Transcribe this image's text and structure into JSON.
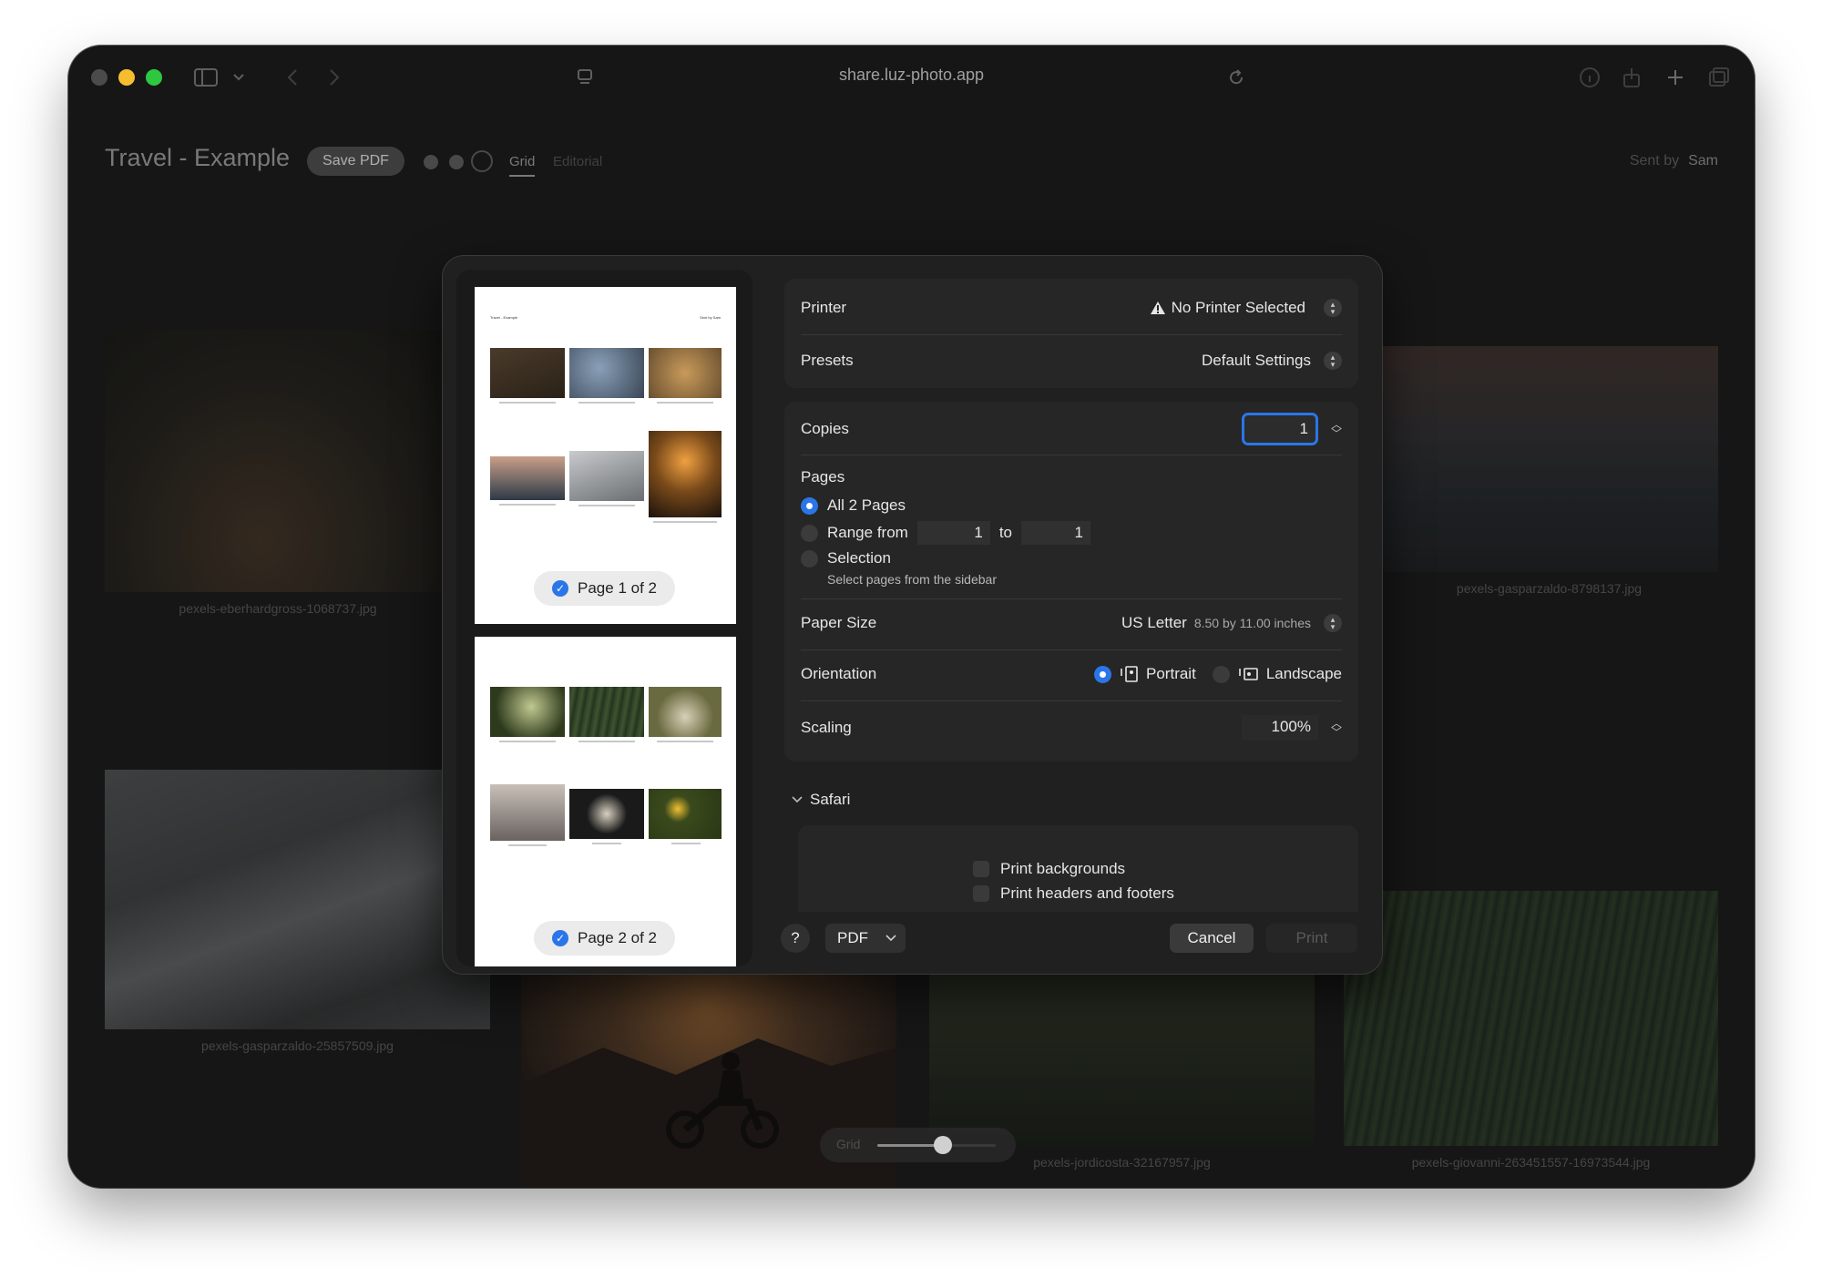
{
  "browser": {
    "url": "share.luz-photo.app"
  },
  "header": {
    "title": "Travel - Example",
    "save_pdf": "Save PDF",
    "tabs": [
      "Grid",
      "Editorial"
    ],
    "sent_by_label": "Sent by",
    "sent_by_name": "Sam"
  },
  "photos": [
    {
      "caption": "pexels-eberhardgross-1068737.jpg"
    },
    {
      "caption": "pexels-gasparzaldo-8798137.jpg"
    },
    {
      "caption": "pexels-gasparzaldo-25857509.jpg"
    },
    {
      "caption": "pexels-jordicosta-32167957.jpg"
    },
    {
      "caption": "pexels-giovanni-263451557-16973544.jpg"
    }
  ],
  "grid_slider": {
    "label": "Grid",
    "value": 0.55
  },
  "print": {
    "preview": {
      "page1_label": "Page 1 of 2",
      "page2_label": "Page 2 of 2",
      "page1_title": "Travel - Example",
      "page1_sent": "Sent by  Sam"
    },
    "printer_label": "Printer",
    "printer_value": "No Printer Selected",
    "presets_label": "Presets",
    "presets_value": "Default Settings",
    "copies_label": "Copies",
    "copies_value": "1",
    "pages_label": "Pages",
    "pages_all": "All 2 Pages",
    "pages_range": "Range from",
    "range_from": "1",
    "range_to_label": "to",
    "range_to": "1",
    "pages_selection": "Selection",
    "pages_selection_hint": "Select pages from the sidebar",
    "paper_label": "Paper Size",
    "paper_value": "US Letter",
    "paper_dims": "8.50 by 11.00 inches",
    "orientation_label": "Orientation",
    "orientation_portrait": "Portrait",
    "orientation_landscape": "Landscape",
    "scaling_label": "Scaling",
    "scaling_value": "100%",
    "safari_section": "Safari",
    "print_backgrounds": "Print backgrounds",
    "print_headers": "Print headers and footers",
    "help": "?",
    "pdf": "PDF",
    "cancel": "Cancel",
    "print": "Print"
  },
  "colors": {
    "accent": "#2a76e8",
    "close_traffic": "#4b4b4b",
    "minimize_traffic": "#f6be2e",
    "maximize_traffic": "#2ec740"
  }
}
